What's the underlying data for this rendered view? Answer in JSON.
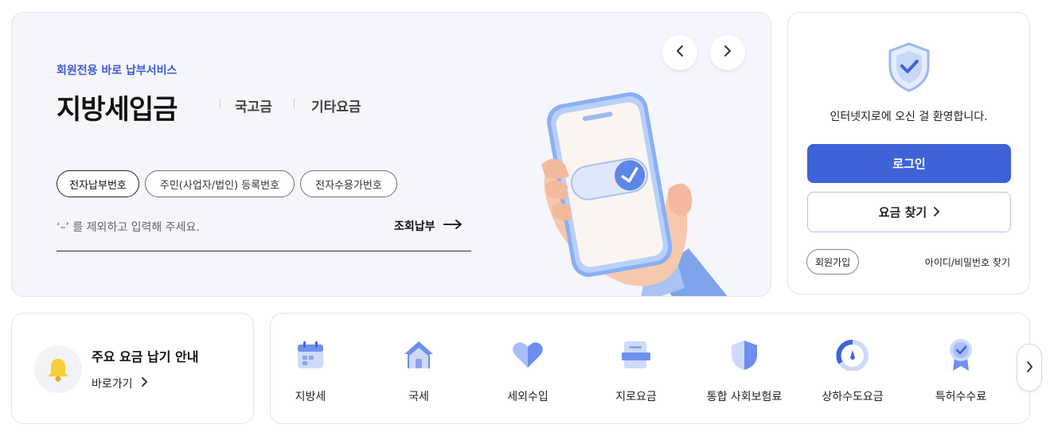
{
  "hero": {
    "subtitle": "회원전용 바로 납부서비스",
    "title": "지방세입금",
    "tabs": [
      "국고금",
      "기타요금"
    ],
    "chips": [
      "전자납부번호",
      "주민(사업자/법인) 등록번호",
      "전자수용가번호"
    ],
    "selected_chip": "전자납부번호",
    "input_placeholder": "‘–’ 를 제외하고 입력해 주세요.",
    "lookup_label": "조회납부",
    "prev_icon": "chevron-left-icon",
    "next_icon": "chevron-right-icon"
  },
  "login": {
    "welcome": "인터넷지로에 오신 걸 환영합니다.",
    "login_label": "로그인",
    "find_fee_label": "요금 찾기",
    "signup_label": "회원가입",
    "find_id_label": "아이디/비밀번호 찾기",
    "shield_icon": "shield-check-icon"
  },
  "notice": {
    "title": "주요 요금 납기 안내",
    "link_label": "바로가기",
    "icon": "bell-icon"
  },
  "services": [
    {
      "label": "지방세",
      "icon": "calendar-icon"
    },
    {
      "label": "국세",
      "icon": "house-icon"
    },
    {
      "label": "세외수입",
      "icon": "heart-icon"
    },
    {
      "label": "지로요금",
      "icon": "document-icon"
    },
    {
      "label": "통합 사회보험료",
      "icon": "shield-icon"
    },
    {
      "label": "상하수도요금",
      "icon": "gauge-icon"
    },
    {
      "label": "특허수수료",
      "icon": "badge-icon"
    }
  ],
  "colors": {
    "accent": "#3e63d8",
    "accent_light": "#8aa3f0",
    "hero_bg": "#f5f6fb"
  }
}
